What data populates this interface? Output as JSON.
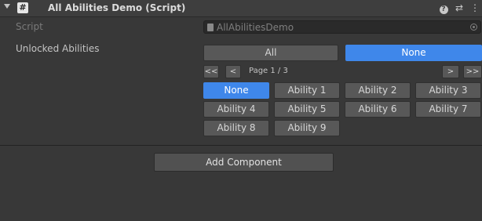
{
  "header": {
    "title": "All Abilities Demo (Script)",
    "script_icon_glyph": "#",
    "icons": [
      "fold-arrow-icon",
      "script-icon",
      "help-icon",
      "presets-icon",
      "context-menu-icon"
    ]
  },
  "fields": {
    "script_label": "Script",
    "script_value": "AllAbilitiesDemo",
    "abilities_label": "Unlocked Abilities"
  },
  "abilities": {
    "all_label": "All",
    "none_label": "None",
    "first_label": "<<",
    "prev_label": "<",
    "next_label": ">",
    "last_label": ">>",
    "page_text": "Page 1 / 3",
    "items": [
      {
        "label": "None",
        "selected": true
      },
      {
        "label": "Ability 1",
        "selected": false
      },
      {
        "label": "Ability 2",
        "selected": false
      },
      {
        "label": "Ability 3",
        "selected": false
      },
      {
        "label": "Ability 4",
        "selected": false
      },
      {
        "label": "Ability 5",
        "selected": false
      },
      {
        "label": "Ability 6",
        "selected": false
      },
      {
        "label": "Ability 7",
        "selected": false
      },
      {
        "label": "Ability 8",
        "selected": false
      },
      {
        "label": "Ability 9",
        "selected": false
      }
    ]
  },
  "footer": {
    "add_component_label": "Add Component"
  },
  "colors": {
    "background": "#383838",
    "header": "#3e3e3e",
    "button": "#585858",
    "selected": "#3f87ea",
    "text": "#c4c4c4"
  }
}
